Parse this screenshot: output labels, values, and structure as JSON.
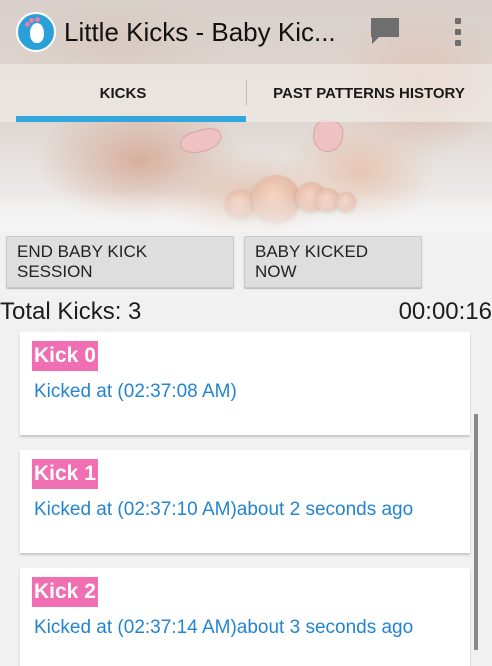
{
  "app": {
    "title": "Little Kicks - Baby Kic...",
    "icons": {
      "app": "app-logo-foot-icon",
      "chat": "chat-bubble-icon",
      "menu": "overflow-menu-icon"
    }
  },
  "tabs": [
    {
      "label": "KICKS",
      "selected": true
    },
    {
      "label": "PAST PATTERNS HISTORY",
      "selected": false
    }
  ],
  "buttons": {
    "end_session": "END BABY KICK SESSION",
    "kicked_now": "BABY KICKED NOW"
  },
  "summary": {
    "total_kicks": "Total Kicks: 3",
    "timer": "00:00:16"
  },
  "kicks": [
    {
      "label": "Kick 0",
      "time": "Kicked at (02:37:08 AM)"
    },
    {
      "label": "Kick 1",
      "time": "Kicked at (02:37:10 AM)about 2 seconds ago"
    },
    {
      "label": "Kick 2",
      "time": "Kicked at (02:37:14 AM)about 3 seconds ago"
    }
  ],
  "colors": {
    "accent": "#33a6de",
    "kick_badge": "#f06fb3",
    "link_text": "#2384d0"
  }
}
